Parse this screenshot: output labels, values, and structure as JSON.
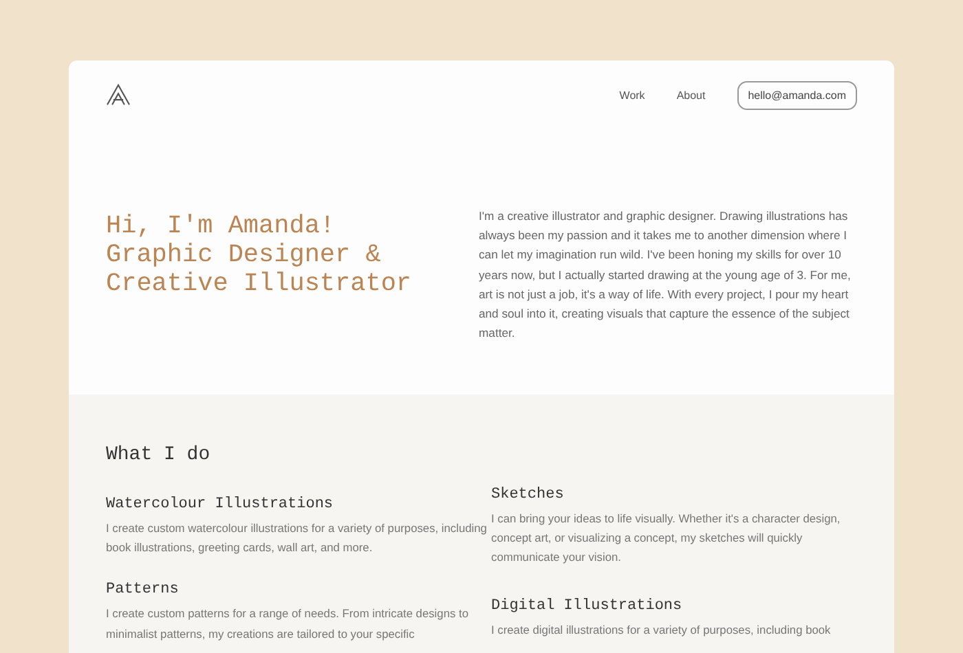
{
  "nav": {
    "links": [
      "Work",
      "About"
    ],
    "email": "hello@amanda.com"
  },
  "hero": {
    "title_lines": [
      "Hi, I'm Amanda!",
      "Graphic Designer &",
      "Creative Illustrator"
    ],
    "bio": "I'm a creative illustrator and graphic designer. Drawing illustrations has always been my passion and it takes me to another dimension where I can let my imagination run wild. I've been honing my skills for over 10 years now, but I actually started drawing at the young age of 3. For me, art is not just a job, it's a way of life. With every project, I pour my heart and soul into it, creating visuals that capture the essence of the subject matter."
  },
  "services": {
    "title": "What I do",
    "columns": [
      [
        {
          "name": "Watercolour Illustrations",
          "text": "I create custom watercolour illustrations for a variety of purposes, including book illustrations, greeting cards, wall art, and more."
        },
        {
          "name": "Patterns",
          "text": "I create custom patterns for a range of needs. From intricate designs to minimalist patterns, my creations are tailored to your specific"
        }
      ],
      [
        {
          "name": "Sketches",
          "text": "I can bring your ideas to life visually. Whether it's a character design, concept art, or visualizing a concept, my sketches will quickly communicate your vision."
        },
        {
          "name": "Digital Illustrations",
          "text": "I create digital illustrations for a variety of purposes, including book"
        }
      ]
    ]
  }
}
